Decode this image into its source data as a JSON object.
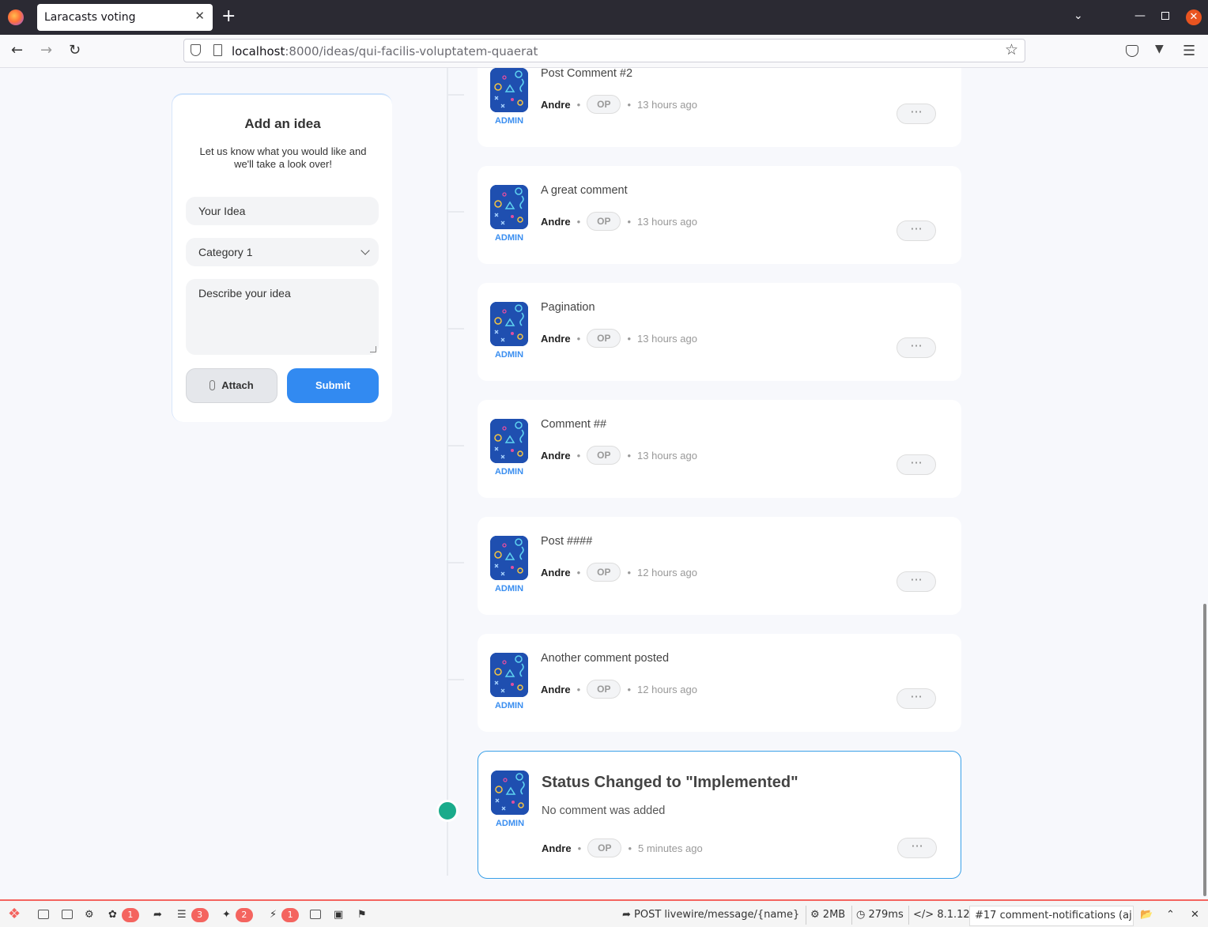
{
  "browser": {
    "tab_title": "Laracasts voting",
    "tab_close": "✕",
    "new_tab": "+",
    "url_host": "localhost",
    "url_path": ":8000/ideas/qui-facilis-voluptatem-quaerat"
  },
  "sidebar": {
    "title": "Add an idea",
    "subtitle": "Let us know what you would like and we'll take a look over!",
    "title_placeholder": "Your Idea",
    "category_selected": "Category 1",
    "description_placeholder": "Describe your idea",
    "attach_label": "Attach",
    "submit_label": "Submit"
  },
  "comments": [
    {
      "body": "Post Comment #2",
      "author": "Andre",
      "badge": "OP",
      "time": "13 hours ago",
      "role": "ADMIN"
    },
    {
      "body": "A great comment",
      "author": "Andre",
      "badge": "OP",
      "time": "13 hours ago",
      "role": "ADMIN"
    },
    {
      "body": "Pagination",
      "author": "Andre",
      "badge": "OP",
      "time": "13 hours ago",
      "role": "ADMIN"
    },
    {
      "body": "Comment ##",
      "author": "Andre",
      "badge": "OP",
      "time": "13 hours ago",
      "role": "ADMIN"
    },
    {
      "body": "Post ####",
      "author": "Andre",
      "badge": "OP",
      "time": "12 hours ago",
      "role": "ADMIN"
    },
    {
      "body": "Another comment posted",
      "author": "Andre",
      "badge": "OP",
      "time": "12 hours ago",
      "role": "ADMIN"
    }
  ],
  "status_comment": {
    "title": "Status Changed to \"Implemented\"",
    "body": "No comment was added",
    "author": "Andre",
    "badge": "OP",
    "time": "5 minutes ago",
    "role": "ADMIN",
    "status_color": "#1aab8b"
  },
  "more_label": "···",
  "debugbar": {
    "badge_views": "1",
    "badge_queries": "3",
    "badge_models": "2",
    "badge_livewire": "1",
    "request": "POST livewire/message/{name}",
    "memory": "2MB",
    "time": "279ms",
    "php_version": "8.1.12",
    "request_select": "#17 comment-notifications (aj",
    "accent": "#f4645f"
  },
  "colors": {
    "primary": "#328af1",
    "admin": "#3a8ef0"
  }
}
